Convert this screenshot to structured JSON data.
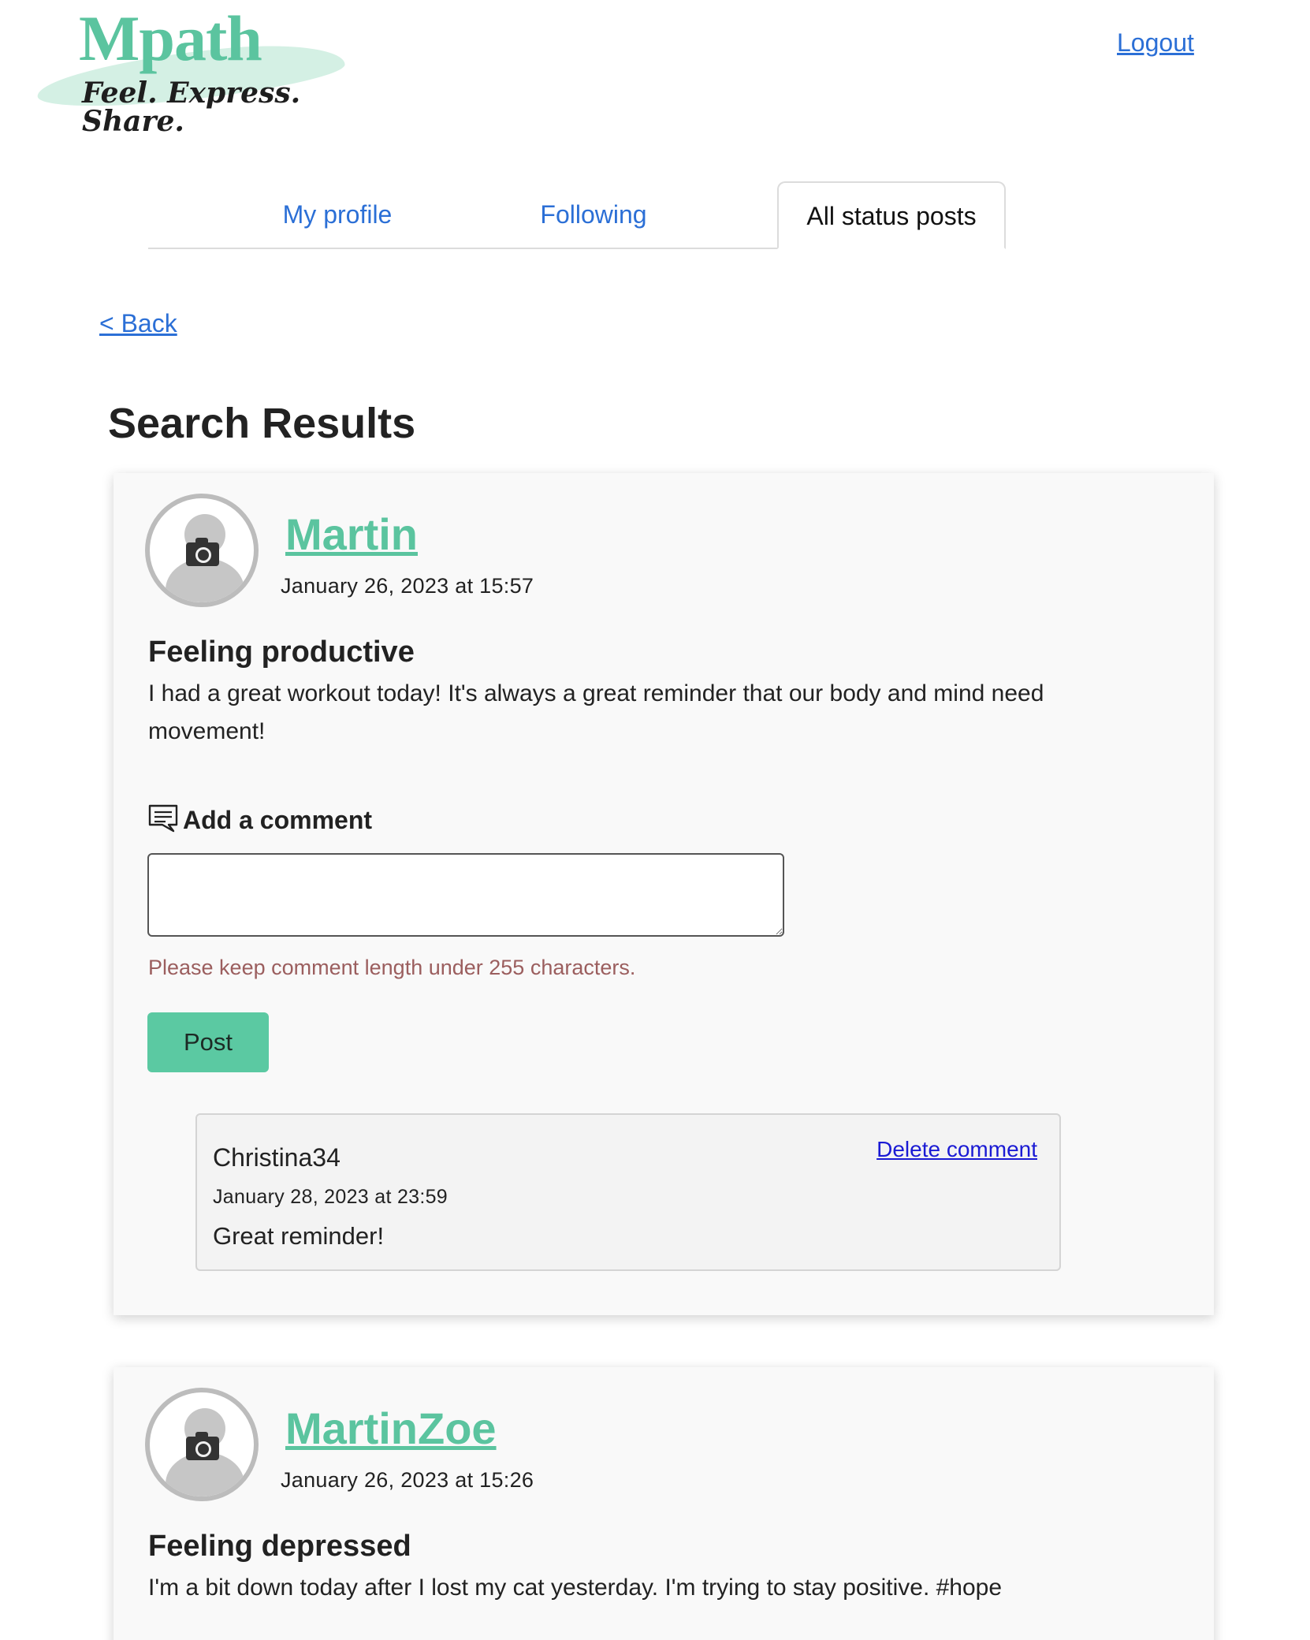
{
  "app": {
    "logo_title": "Mpath",
    "logo_tagline": "Feel. Express. Share.",
    "logout_label": "Logout",
    "brand_color": "#5bc49f",
    "link_color": "#2b6fd6"
  },
  "tabs": [
    {
      "label": "My profile",
      "active": false
    },
    {
      "label": "Following",
      "active": false
    },
    {
      "label": "All status posts",
      "active": true
    }
  ],
  "back_label": "< Back",
  "page_title": "Search Results",
  "posts": [
    {
      "username": "Martin",
      "date": "January 26, 2023 at 15:57",
      "title": "Feeling productive",
      "body": "I had a great workout today! It's always a great reminder that our body and mind need movement!",
      "comment_label": "Add a comment",
      "comment_value": "",
      "comment_hint": "Please keep comment length under 255 characters.",
      "post_button": "Post",
      "comments": [
        {
          "user": "Christina34",
          "date": "January 28, 2023 at 23:59",
          "text": "Great reminder!",
          "delete_label": "Delete comment"
        }
      ]
    },
    {
      "username": "MartinZoe",
      "date": "January 26, 2023 at 15:26",
      "title": "Feeling depressed",
      "body": "I'm a bit down today after I lost my cat yesterday. I'm trying to stay positive. #hope"
    }
  ]
}
